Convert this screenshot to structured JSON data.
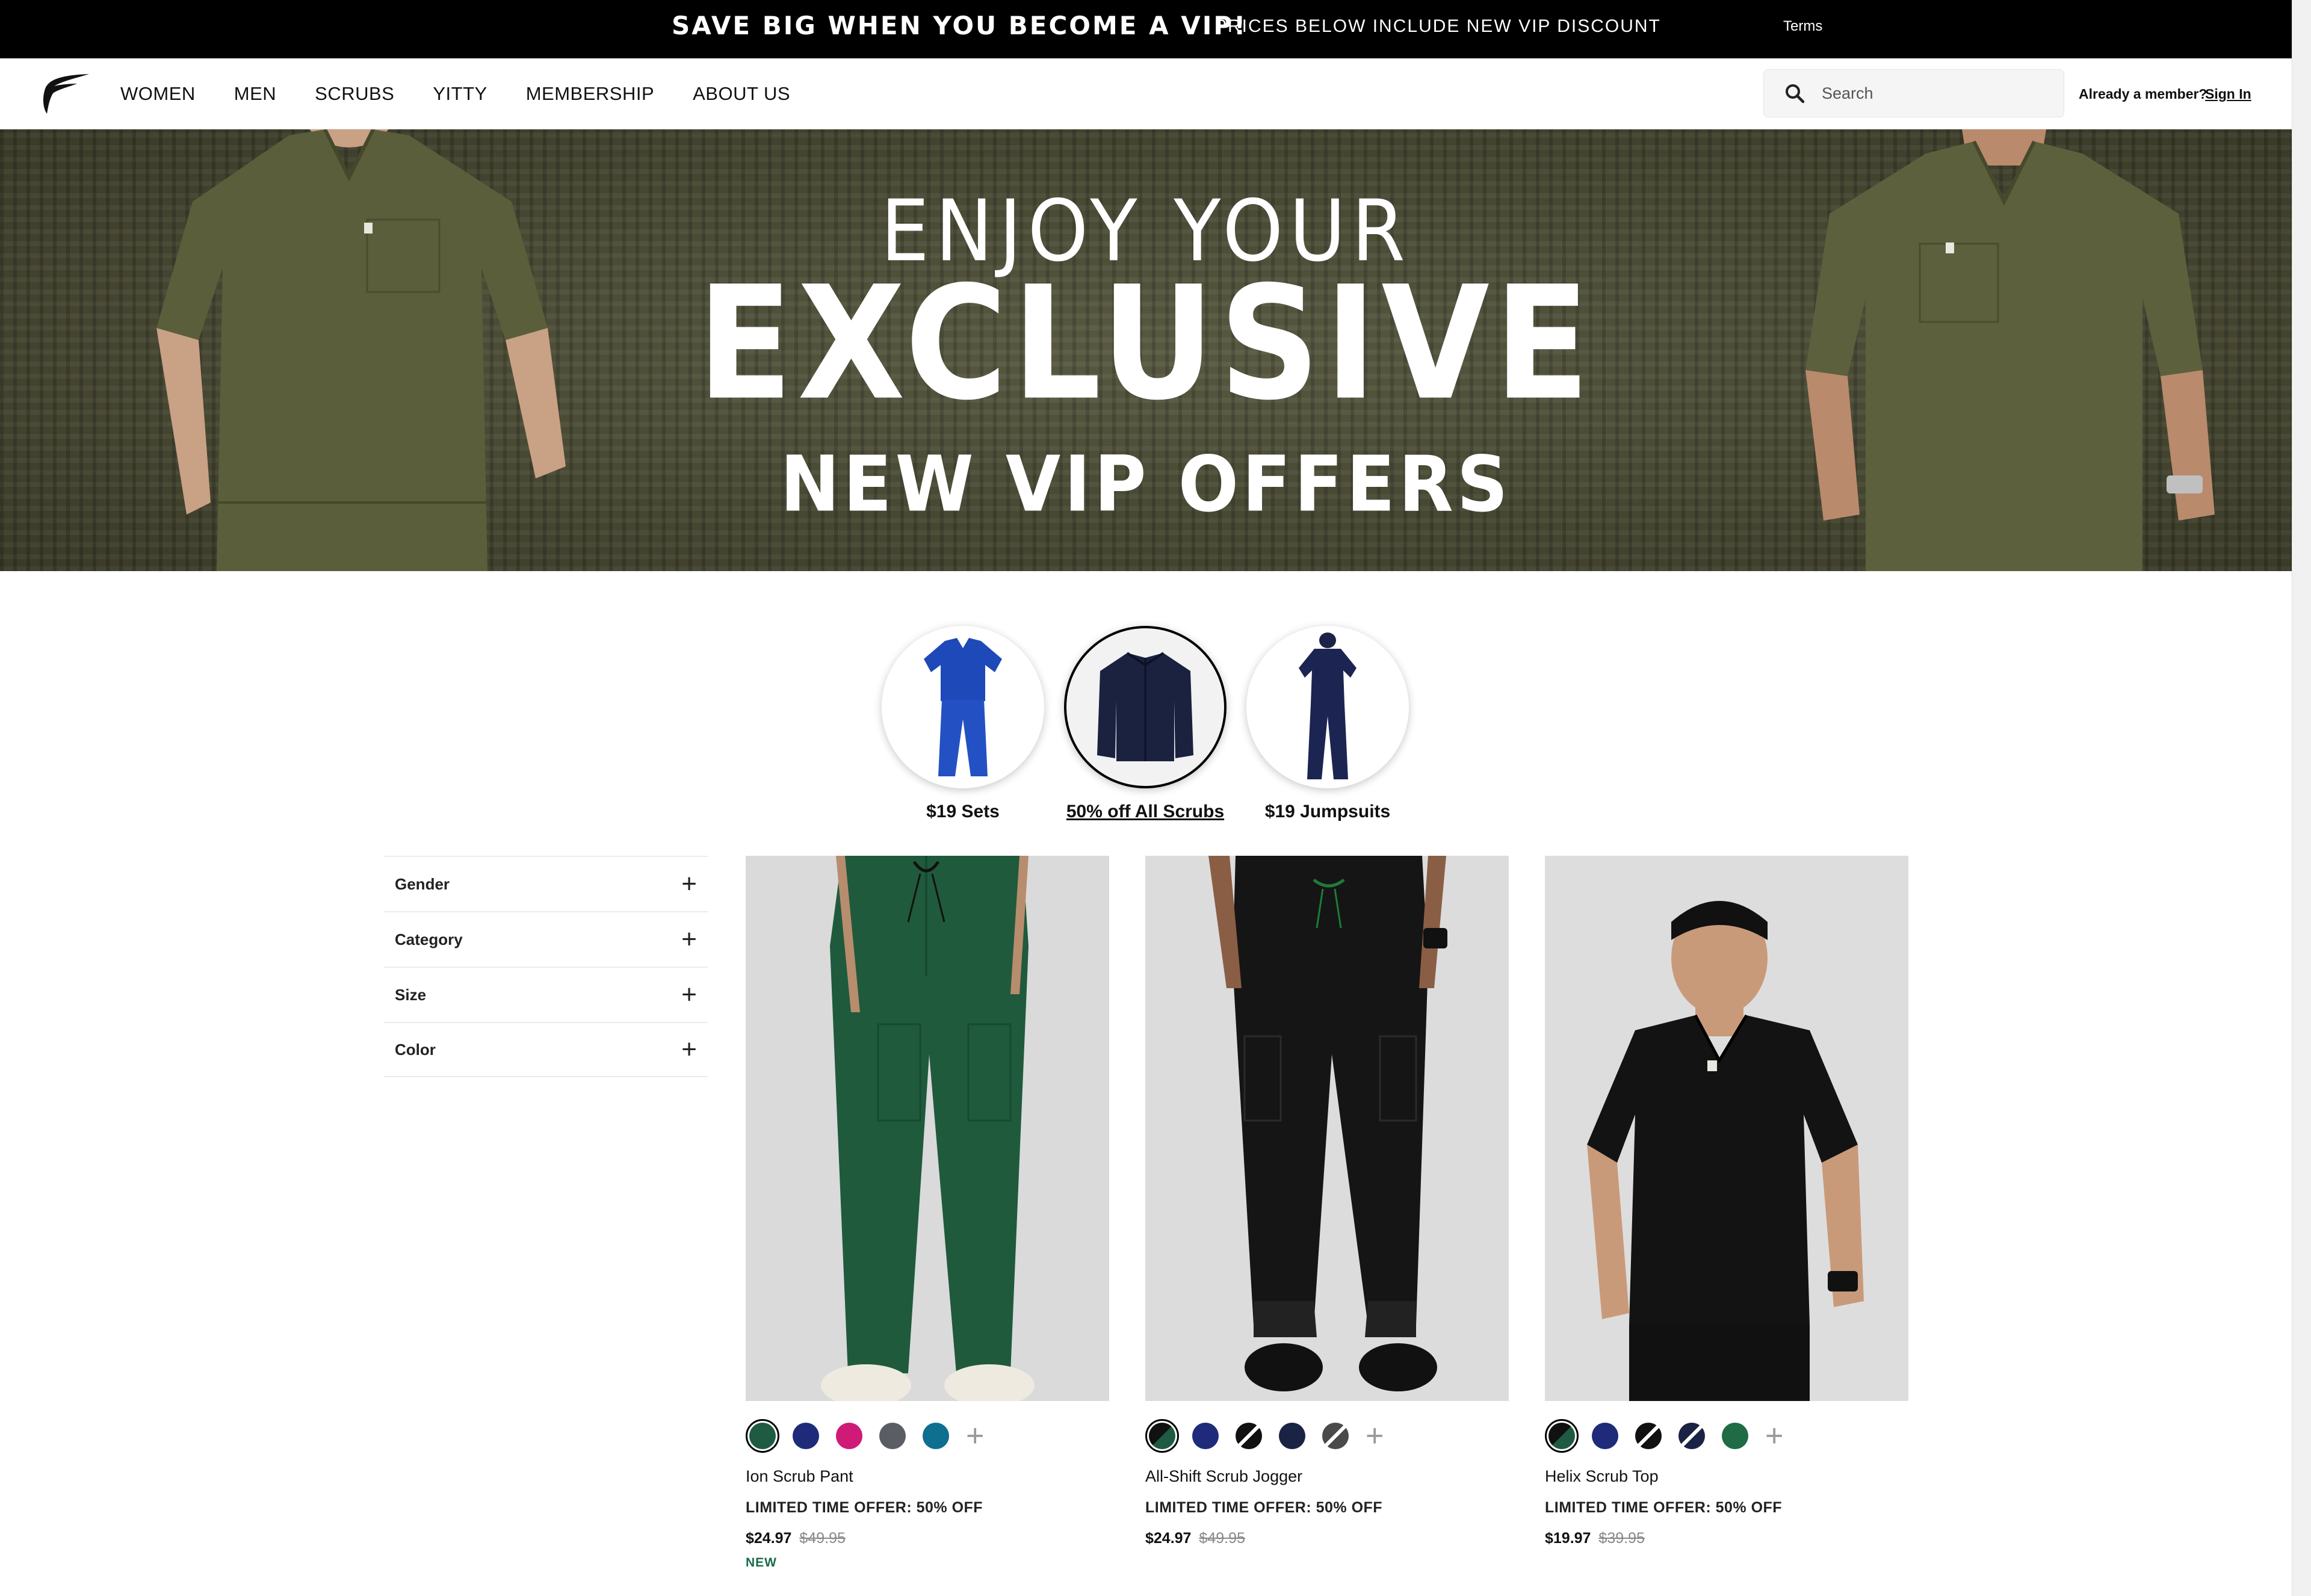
{
  "promo": {
    "headline": "SAVE BIG WHEN YOU BECOME A VIP!",
    "subtext": "PRICES BELOW INCLUDE NEW VIP DISCOUNT",
    "terms": "Terms"
  },
  "nav": {
    "links": [
      "WOMEN",
      "MEN",
      "SCRUBS",
      "YITTY",
      "MEMBERSHIP",
      "ABOUT US"
    ],
    "search_placeholder": "Search",
    "member_text": "Already a member?",
    "sign_in": "Sign In"
  },
  "hero": {
    "line1": "ENJOY YOUR",
    "line2": "EXCLUSIVE",
    "line3": "NEW VIP OFFERS"
  },
  "categories": [
    {
      "label": "$19 Sets",
      "active": false,
      "icon": "scrub-set-icon"
    },
    {
      "label": "50% off All Scrubs",
      "active": true,
      "icon": "jacket-icon"
    },
    {
      "label": "$19 Jumpsuits",
      "active": false,
      "icon": "jumpsuit-icon"
    }
  ],
  "filters": [
    "Gender",
    "Category",
    "Size",
    "Color"
  ],
  "products": [
    {
      "name": "Ion Scrub Pant",
      "offer": "LIMITED TIME OFFER: 50% OFF",
      "price": "$24.97",
      "was_price": "$49.95",
      "badge": "NEW",
      "swatches": [
        "#1f5a42",
        "#1f2a7a",
        "#d01a78",
        "#5a5d63",
        "#0e6f8e"
      ]
    },
    {
      "name": "All-Shift Scrub Jogger",
      "offer": "LIMITED TIME OFFER: 50% OFF",
      "price": "$24.97",
      "was_price": "$49.95",
      "badge": "",
      "swatches": [
        "#1f5a42",
        "#1f2a7a",
        "#111111",
        "#1b2344",
        "#4a4a4a"
      ]
    },
    {
      "name": "Helix Scrub Top",
      "offer": "LIMITED TIME OFFER: 50% OFF",
      "price": "$19.97",
      "was_price": "$39.95",
      "badge": "",
      "swatches": [
        "#1f5a42",
        "#1f2a7a",
        "#111111",
        "#1b2344",
        "#1e6b45"
      ]
    }
  ],
  "colors": {
    "promo_bg": "#000000",
    "hero_bg": "#4d4e34",
    "badge_green": "#1a6b48"
  }
}
